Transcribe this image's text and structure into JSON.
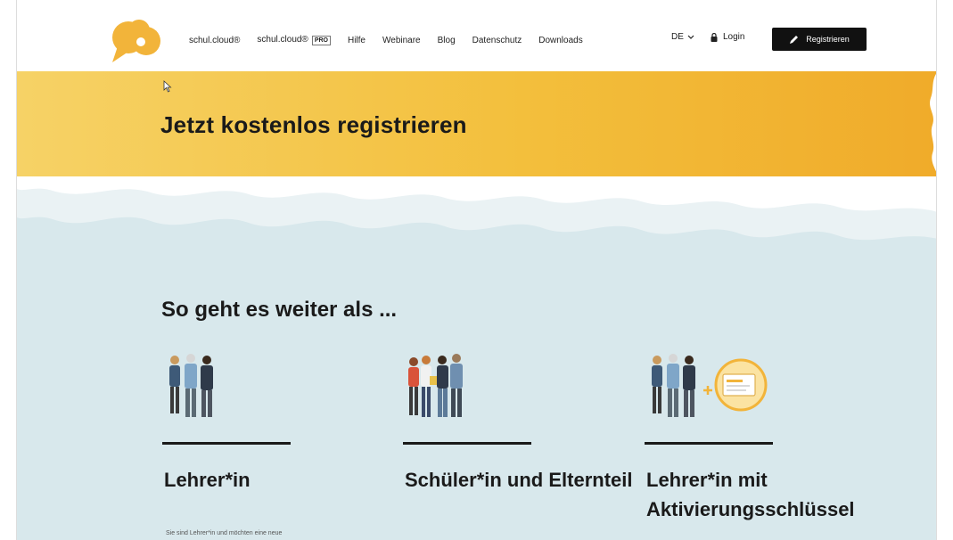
{
  "nav": {
    "items": [
      {
        "label": "schul.cloud®"
      },
      {
        "label": "schul.cloud®",
        "badge": "PRO"
      },
      {
        "label": "Hilfe"
      },
      {
        "label": "Webinare"
      },
      {
        "label": "Blog"
      },
      {
        "label": "Datenschutz"
      },
      {
        "label": "Downloads"
      }
    ],
    "language": "DE",
    "login_label": "Login",
    "register_label": "Registrieren"
  },
  "banner": {
    "title": "Jetzt kostenlos registrieren"
  },
  "section": {
    "title": "So geht es weiter als ...",
    "cards": [
      {
        "title": "Lehrer*in",
        "description": "Sie sind Lehrer*in und möchten eine neue",
        "illustration": "teachers-illustration"
      },
      {
        "title": "Schüler*in und Elternteil",
        "description": "",
        "illustration": "students-parents-illustration"
      },
      {
        "title": "Lehrer*in mit Aktivierungsschlüssel",
        "description": "",
        "illustration": "teachers-key-illustration"
      }
    ]
  },
  "colors": {
    "banner_start": "#f6d266",
    "banner_end": "#f0ab2a",
    "logo": "#f2b43a",
    "sky": "#d8e8ec",
    "button": "#111111"
  }
}
